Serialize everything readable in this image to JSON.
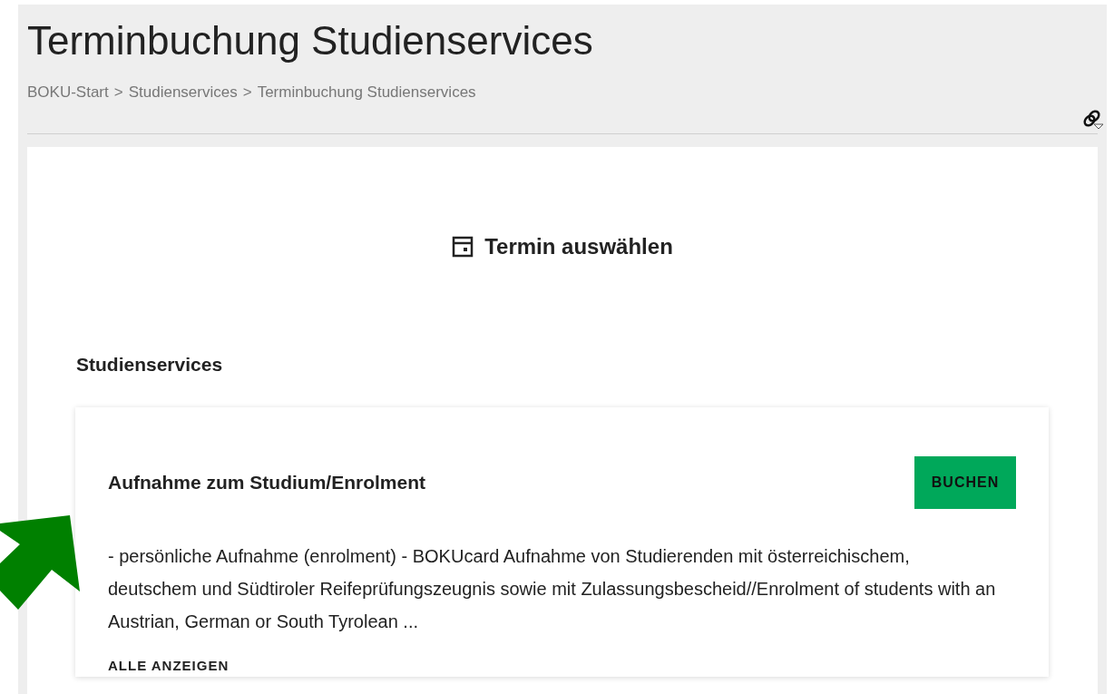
{
  "page_title": "Terminbuchung Studienservices",
  "breadcrumb": [
    {
      "label": "BOKU-Start"
    },
    {
      "label": "Studienservices"
    },
    {
      "label": "Terminbuchung Studienservices"
    }
  ],
  "breadcrumb_separator": ">",
  "section_heading": "Termin auswählen",
  "category": "Studienservices",
  "services": [
    {
      "title": "Aufnahme zum Studium/Enrolment",
      "button": "BUCHEN",
      "description": "- persönliche Aufnahme (enrolment) - BOKUcard Aufnahme von Studierenden mit österreichischem, deutschem und Südtiroler Reifeprüfungszeugnis sowie mit Zulassungsbescheid//Enrolment of students with an Austrian, German or South Tyrolean ...",
      "link": "ALLE ANZEIGEN"
    }
  ]
}
